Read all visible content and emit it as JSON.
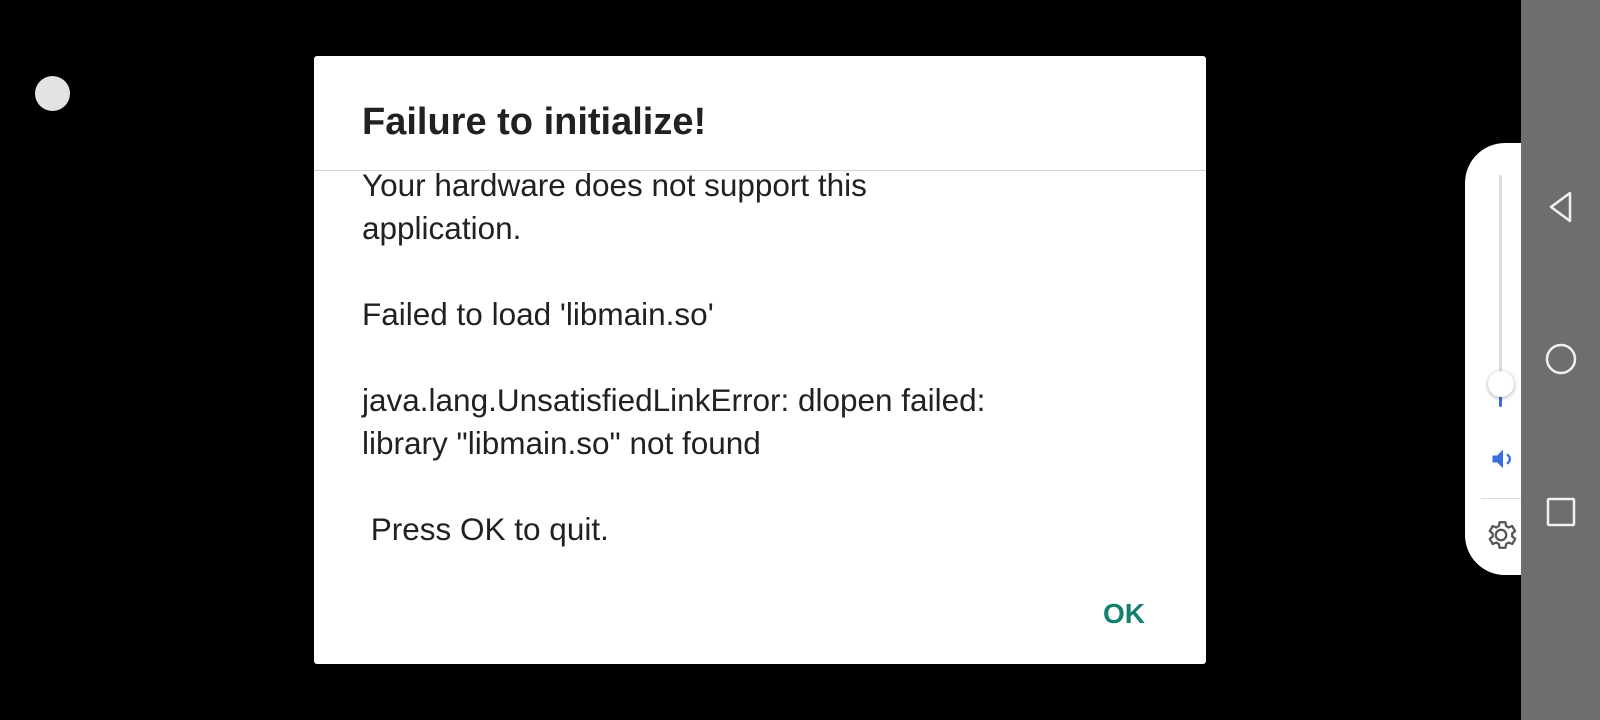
{
  "dialog": {
    "title": "Failure to initialize!",
    "message_lines": [
      "Your hardware does not support this",
      "application.",
      "",
      "Failed to load 'libmain.so'",
      "",
      "java.lang.UnsatisfiedLinkError: dlopen failed:",
      "library \"libmain.so\" not found",
      "",
      " Press OK to quit."
    ],
    "ok_label": "OK"
  },
  "volume_panel": {
    "level": 0.1,
    "speaker_icon": "speaker-icon",
    "settings_icon": "gear-icon"
  },
  "nav_bar": {
    "buttons": [
      "back-icon",
      "home-icon",
      "recents-icon"
    ]
  },
  "colors": {
    "background": "#000000",
    "dialog": "#ffffff",
    "ok_accent": "#14806f",
    "volume_accent": "#3b6fe0",
    "nav_bar": "#6e6e70"
  }
}
